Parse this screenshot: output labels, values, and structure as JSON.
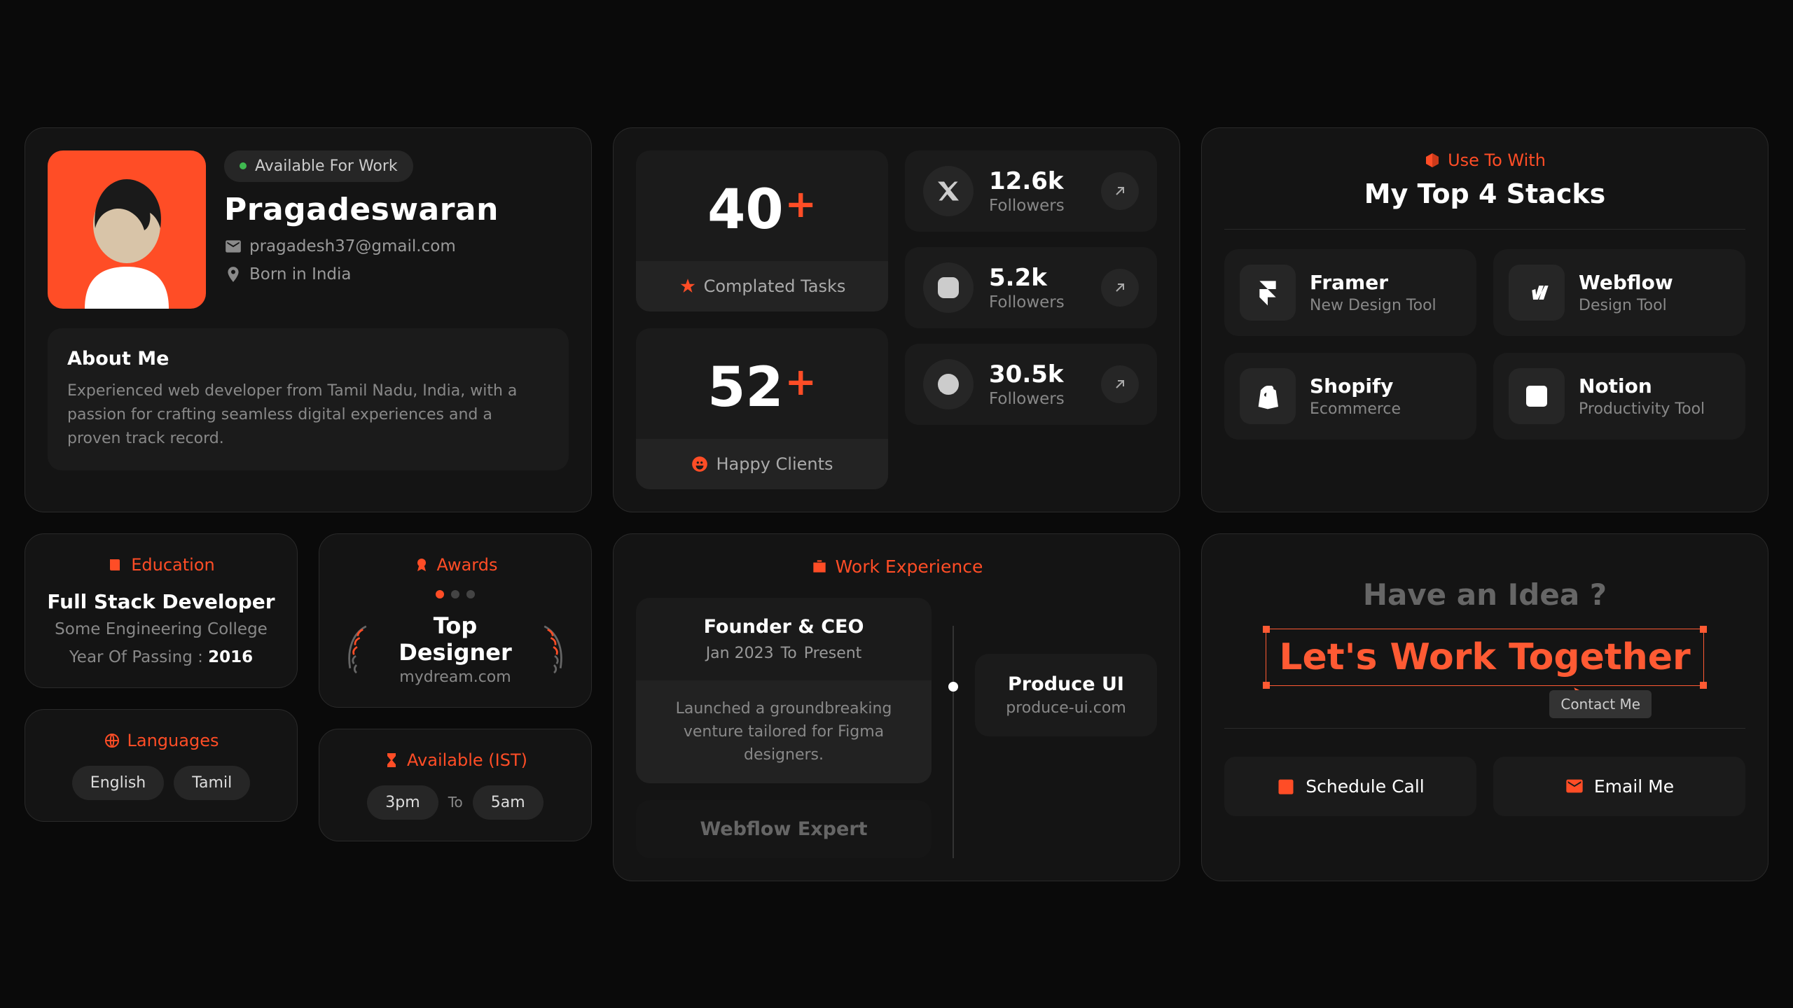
{
  "profile": {
    "availability": "Available For Work",
    "name": "Pragadeswaran",
    "email": "pragadesh37@gmail.com",
    "location": "Born in India",
    "about_title": "About Me",
    "about_body": "Experienced web developer from Tamil Nadu, India, with a passion for crafting seamless digital experiences and a proven track record."
  },
  "stats": {
    "tasks": {
      "num": "40",
      "label": "Complated Tasks"
    },
    "clients": {
      "num": "52",
      "label": "Happy Clients"
    }
  },
  "socials": [
    {
      "name": "twitter",
      "count": "12.6k",
      "label": "Followers"
    },
    {
      "name": "instagram",
      "count": "5.2k",
      "label": "Followers"
    },
    {
      "name": "dribbble",
      "count": "30.5k",
      "label": "Followers"
    }
  ],
  "stacks": {
    "tag": "Use To With",
    "title": "My Top 4 Stacks",
    "items": [
      {
        "name": "Framer",
        "desc": "New Design Tool"
      },
      {
        "name": "Webflow",
        "desc": "Design Tool"
      },
      {
        "name": "Shopify",
        "desc": "Ecommerce"
      },
      {
        "name": "Notion",
        "desc": "Productivity Tool"
      }
    ]
  },
  "education": {
    "header": "Education",
    "title": "Full Stack Developer",
    "school": "Some Engineering College",
    "year_label": "Year Of Passing  :",
    "year": "2016"
  },
  "awards": {
    "header": "Awards",
    "title": "Top Designer",
    "sub": "mydream.com"
  },
  "languages": {
    "header": "Languages",
    "items": [
      "English",
      "Tamil"
    ]
  },
  "available": {
    "header": "Available (IST)",
    "from": "3pm",
    "to_label": "To",
    "to": "5am"
  },
  "work": {
    "header": "Work Experience",
    "role": "Founder & CEO",
    "from": "Jan 2023",
    "to_label": "To",
    "to": "Present",
    "desc": "Launched a groundbreaking venture tailored for Figma designers.",
    "next_role": "Webflow Expert",
    "company": "Produce UI",
    "company_url": "produce-ui.com"
  },
  "cta": {
    "ask": "Have an Idea ?",
    "together": "Let's Work Together",
    "contact": "Contact Me",
    "schedule": "Schedule Call",
    "email": "Email Me"
  }
}
